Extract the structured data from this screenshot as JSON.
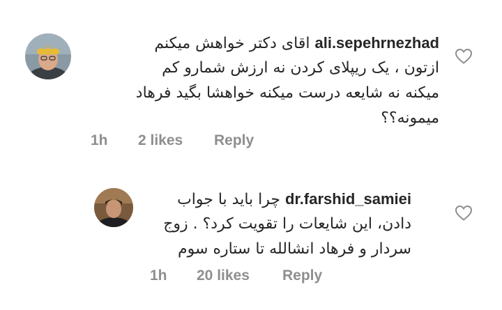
{
  "comments": [
    {
      "username": "ali.sepehrnezhad",
      "line1": "اقای دکتر خواهش میکنم",
      "line2": "ازتون ، یک ریپلای کردن نه ارزش شمارو کم",
      "line3": "میکنه نه شایعه درست میکنه خواهشا بگید فرهاد",
      "line4": "میمونه؟؟",
      "time": "1h",
      "likes": "2 likes",
      "reply": "Reply"
    },
    {
      "username": "dr.farshid_samiei",
      "line1": "چرا باید با جواب",
      "line2": "دادن، این شایعات را تقویت کرد؟ . زوج",
      "line3": "سردار و فرهاد انشالله تا ستاره سوم",
      "time": "1h",
      "likes": "20 likes",
      "reply": "Reply"
    }
  ]
}
